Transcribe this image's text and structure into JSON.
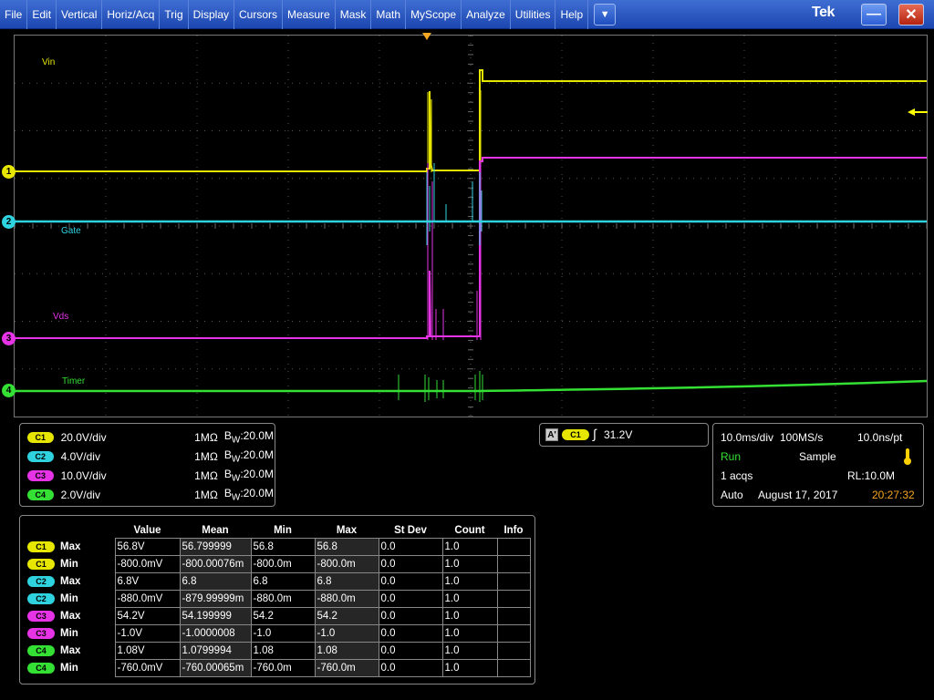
{
  "menu": {
    "items": [
      "File",
      "Edit",
      "Vertical",
      "Horiz/Acq",
      "Trig",
      "Display",
      "Cursors",
      "Measure",
      "Mask",
      "Math",
      "MyScope",
      "Analyze",
      "Utilities",
      "Help"
    ],
    "brand": "Tek",
    "dropdown_glyph": "▼",
    "minimize_glyph": "—",
    "close_glyph": "✕"
  },
  "colors": {
    "ch1": "#e6e600",
    "ch2": "#2fd3e0",
    "ch3": "#e633e6",
    "ch4": "#33e033",
    "menubar": "#2a56c4",
    "trigger": "#f5a623"
  },
  "waveforms": {
    "labels": {
      "ch1": "Vin",
      "ch2": "Gate",
      "ch3": "Vds",
      "ch4": "Timer"
    },
    "markers": [
      "1",
      "2",
      "3",
      "4"
    ]
  },
  "channels": [
    {
      "badge": "C1",
      "scale": "20.0V/div",
      "impedance": "1MΩ",
      "bw_prefix": "B",
      "bw_sub": "W",
      "bw_value": ":20.0M"
    },
    {
      "badge": "C2",
      "scale": "4.0V/div",
      "impedance": "1MΩ",
      "bw_prefix": "B",
      "bw_sub": "W",
      "bw_value": ":20.0M"
    },
    {
      "badge": "C3",
      "scale": "10.0V/div",
      "impedance": "1MΩ",
      "bw_prefix": "B",
      "bw_sub": "W",
      "bw_value": ":20.0M"
    },
    {
      "badge": "C4",
      "scale": "2.0V/div",
      "impedance": "1MΩ",
      "bw_prefix": "B",
      "bw_sub": "W",
      "bw_value": ":20.0M"
    }
  ],
  "trigger": {
    "mode_letter": "A'",
    "source": "C1",
    "slope_glyph": "∫",
    "level": "31.2V"
  },
  "acquisition": {
    "timebase": "10.0ms/div",
    "sample_rate": "100MS/s",
    "resolution": "10.0ns/pt",
    "state": "Run",
    "mode": "Sample",
    "acqs": "1 acqs",
    "record_length": "RL:10.0M",
    "trigger_mode": "Auto",
    "date": "August 17, 2017",
    "time": "20:27:32"
  },
  "measurements": {
    "headers": [
      "Value",
      "Mean",
      "Min",
      "Max",
      "St Dev",
      "Count",
      "Info"
    ],
    "rows": [
      {
        "src": "C1",
        "type": "Max",
        "value": "56.8V",
        "mean": "56.799999",
        "min": "56.8",
        "max": "56.8",
        "stdev": "0.0",
        "count": "1.0",
        "info": ""
      },
      {
        "src": "C1",
        "type": "Min",
        "value": "-800.0mV",
        "mean": "-800.00076m",
        "min": "-800.0m",
        "max": "-800.0m",
        "stdev": "0.0",
        "count": "1.0",
        "info": ""
      },
      {
        "src": "C2",
        "type": "Max",
        "value": "6.8V",
        "mean": "6.8",
        "min": "6.8",
        "max": "6.8",
        "stdev": "0.0",
        "count": "1.0",
        "info": ""
      },
      {
        "src": "C2",
        "type": "Min",
        "value": "-880.0mV",
        "mean": "-879.99999m",
        "min": "-880.0m",
        "max": "-880.0m",
        "stdev": "0.0",
        "count": "1.0",
        "info": ""
      },
      {
        "src": "C3",
        "type": "Max",
        "value": "54.2V",
        "mean": "54.199999",
        "min": "54.2",
        "max": "54.2",
        "stdev": "0.0",
        "count": "1.0",
        "info": ""
      },
      {
        "src": "C3",
        "type": "Min",
        "value": "-1.0V",
        "mean": "-1.0000008",
        "min": "-1.0",
        "max": "-1.0",
        "stdev": "0.0",
        "count": "1.0",
        "info": ""
      },
      {
        "src": "C4",
        "type": "Max",
        "value": "1.08V",
        "mean": "1.0799994",
        "min": "1.08",
        "max": "1.08",
        "stdev": "0.0",
        "count": "1.0",
        "info": ""
      },
      {
        "src": "C4",
        "type": "Min",
        "value": "-760.0mV",
        "mean": "-760.00065m",
        "min": "-760.0m",
        "max": "-760.0m",
        "stdev": "0.0",
        "count": "1.0",
        "info": ""
      }
    ]
  }
}
